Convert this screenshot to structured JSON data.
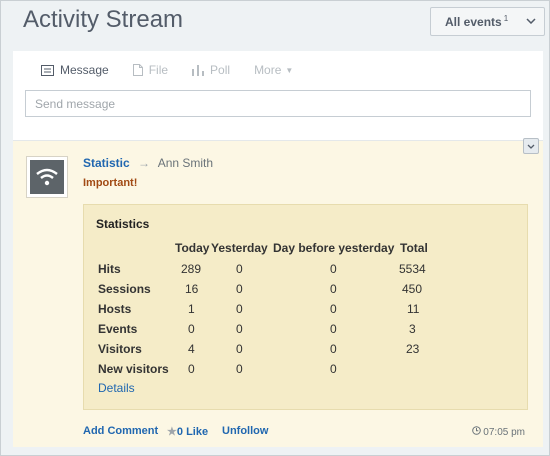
{
  "header": {
    "title": "Activity Stream",
    "filter_label": "All events",
    "filter_count": "1"
  },
  "composer": {
    "tabs": [
      {
        "label": "Message",
        "icon": "message-icon"
      },
      {
        "label": "File",
        "icon": "file-icon"
      },
      {
        "label": "Poll",
        "icon": "poll-icon"
      },
      {
        "label": "More",
        "icon": "caret-down-icon"
      }
    ],
    "placeholder": "Send message"
  },
  "post": {
    "author": "Statistic",
    "recipient": "Ann Smith",
    "important": "Important!",
    "statistics": {
      "title": "Statistics",
      "columns": [
        "Today",
        "Yesterday",
        "Day before yesterday",
        "Total"
      ],
      "rows": [
        {
          "label": "Hits",
          "today": "289",
          "yesterday": "0",
          "day_before": "0",
          "total": "5534"
        },
        {
          "label": "Sessions",
          "today": "16",
          "yesterday": "0",
          "day_before": "0",
          "total": "450"
        },
        {
          "label": "Hosts",
          "today": "1",
          "yesterday": "0",
          "day_before": "0",
          "total": "11"
        },
        {
          "label": "Events",
          "today": "0",
          "yesterday": "0",
          "day_before": "0",
          "total": "3"
        },
        {
          "label": "Visitors",
          "today": "4",
          "yesterday": "0",
          "day_before": "0",
          "total": "23"
        },
        {
          "label": "New visitors",
          "today": "0",
          "yesterday": "0",
          "day_before": "0",
          "total": ""
        }
      ],
      "details_link": "Details"
    },
    "footer": {
      "add_comment": "Add Comment",
      "like_count": "0",
      "like": "Like",
      "unfollow": "Unfollow",
      "time": "07:05 pm"
    }
  },
  "colors": {
    "link": "#2067b0",
    "important": "#a14a14",
    "post_bg": "#fcf7e4",
    "stat_bg": "#f5ecc8"
  }
}
